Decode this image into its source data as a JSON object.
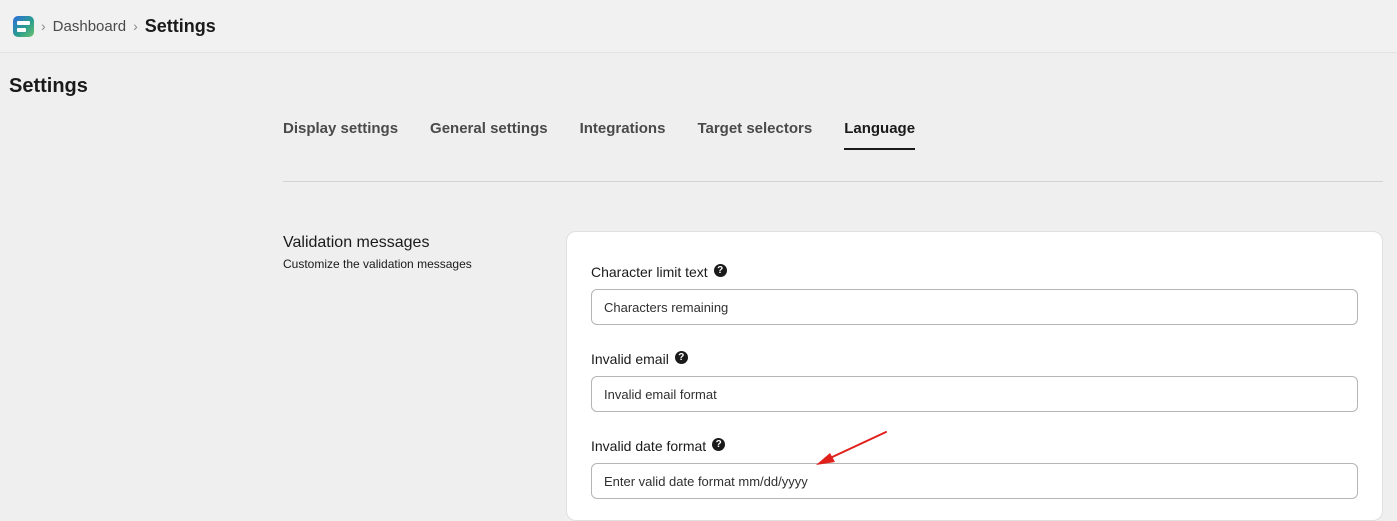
{
  "breadcrumb": {
    "app_icon": "app-logo-icon",
    "separator": "›",
    "items": [
      {
        "label": "Dashboard"
      },
      {
        "label": "Settings"
      }
    ]
  },
  "page": {
    "title": "Settings"
  },
  "tabs": [
    {
      "label": "Display settings",
      "active": false
    },
    {
      "label": "General settings",
      "active": false
    },
    {
      "label": "Integrations",
      "active": false
    },
    {
      "label": "Target selectors",
      "active": false
    },
    {
      "label": "Language",
      "active": true
    }
  ],
  "section": {
    "heading": "Validation messages",
    "description": "Customize the validation messages"
  },
  "fields": [
    {
      "label": "Character limit text",
      "value": "Characters remaining",
      "help_icon": "question-circle-icon"
    },
    {
      "label": "Invalid email",
      "value": "Invalid email format",
      "help_icon": "question-circle-icon"
    },
    {
      "label": "Invalid date format",
      "value": "Enter valid date format mm/dd/yyyy",
      "help_icon": "question-circle-icon"
    }
  ],
  "help_glyph": "?",
  "annotation": {
    "type": "arrow",
    "color": "#e0201b"
  },
  "colors": {
    "background": "#efefef",
    "card": "#ffffff",
    "text": "#1a1a1a"
  }
}
